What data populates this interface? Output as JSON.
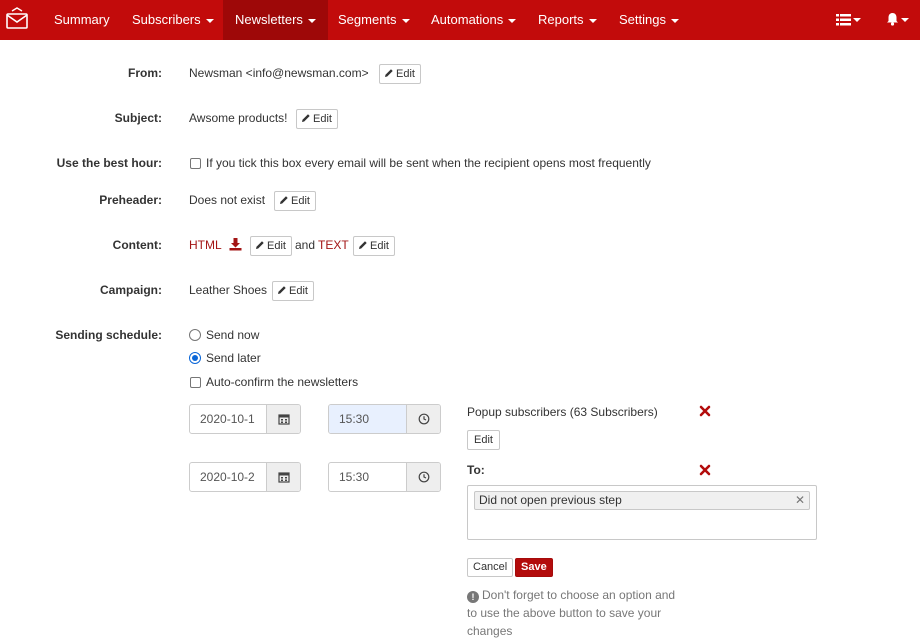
{
  "nav": {
    "items": [
      {
        "label": "Summary",
        "has_caret": false
      },
      {
        "label": "Subscribers",
        "has_caret": true
      },
      {
        "label": "Newsletters",
        "has_caret": true,
        "active": true
      },
      {
        "label": "Segments",
        "has_caret": true
      },
      {
        "label": "Automations",
        "has_caret": true
      },
      {
        "label": "Reports",
        "has_caret": true
      },
      {
        "label": "Settings",
        "has_caret": true
      }
    ],
    "right_icons": [
      "list-icon",
      "bell-icon"
    ],
    "brand_color": "#c20b0b",
    "active_color": "#9e0808"
  },
  "form": {
    "from": {
      "label": "From:",
      "value": "Newsman <info@newsman.com>",
      "edit": "Edit"
    },
    "subject": {
      "label": "Subject:",
      "value": "Awsome products!",
      "edit": "Edit"
    },
    "best_hour": {
      "label": "Use the best hour:",
      "checkbox_text": "If you tick this box every email will be sent when the recipient opens most frequently",
      "checked": false
    },
    "preheader": {
      "label": "Preheader:",
      "value": "Does not exist",
      "edit": "Edit"
    },
    "content": {
      "label": "Content:",
      "html_link": "HTML",
      "html_edit": "Edit",
      "and": "and",
      "text_link": "TEXT",
      "text_edit": "Edit"
    },
    "campaign": {
      "label": "Campaign:",
      "value": "Leather Shoes",
      "edit": "Edit"
    },
    "schedule": {
      "label": "Sending schedule:",
      "send_now": "Send now",
      "send_later": "Send later",
      "selected": "Send later",
      "auto_confirm": "Auto-confirm the newsletters",
      "auto_confirm_checked": false
    }
  },
  "steps": [
    {
      "date": "2020-10-1",
      "time": "15:30",
      "audience": "Popup subscribers (63 Subscribers)",
      "edit": "Edit"
    },
    {
      "date": "2020-10-2",
      "time": "15:30",
      "to_label": "To:",
      "tags": [
        "Did not open previous step"
      ]
    }
  ],
  "actions": {
    "cancel": "Cancel",
    "save": "Save"
  },
  "hint": "Don't forget to choose an option and to use the above button to save your changes",
  "colors": {
    "accent_red": "#a31515",
    "remove_red": "#b30c0c"
  }
}
